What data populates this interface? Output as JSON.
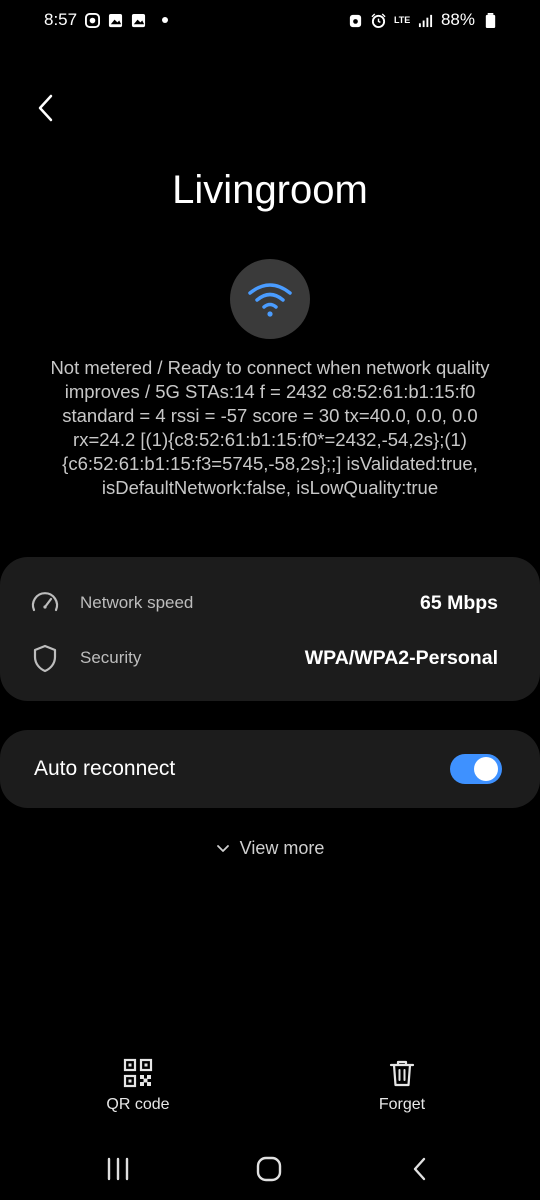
{
  "status_bar": {
    "time": "8:57",
    "network_type": "LTE",
    "battery": "88%"
  },
  "header": {
    "back_icon": "chevron-left-icon",
    "title": "Livingroom"
  },
  "wifi": {
    "icon": "wifi-icon",
    "color": "#4a9cff"
  },
  "details_text": "Not metered / Ready to connect when network quality improves / 5G STAs:14 f = 2432 c8:52:61:b1:15:f0 standard = 4 rssi = -57 score = 30  tx=40.0, 0.0, 0.0  rx=24.2 [(1){c8:52:61:b1:15:f0*=2432,-54,2s};(1){c6:52:61:b1:15:f3=5745,-58,2s};;] isValidated:true, isDefaultNetwork:false, isLowQuality:true",
  "info": {
    "rows": [
      {
        "icon": "speedometer-icon",
        "label": "Network speed",
        "value": "65 Mbps"
      },
      {
        "icon": "shield-icon",
        "label": "Security",
        "value": "WPA/WPA2-Personal"
      }
    ]
  },
  "auto_reconnect": {
    "label": "Auto reconnect",
    "enabled": true,
    "accent": "#3e91ff"
  },
  "view_more": {
    "label": "View more"
  },
  "actions": {
    "qr": {
      "icon": "qr-code-icon",
      "label": "QR code"
    },
    "forget": {
      "icon": "trash-icon",
      "label": "Forget"
    }
  },
  "nav": {
    "recents_icon": "recents-icon",
    "home_icon": "home-icon",
    "back_icon": "back-icon"
  }
}
